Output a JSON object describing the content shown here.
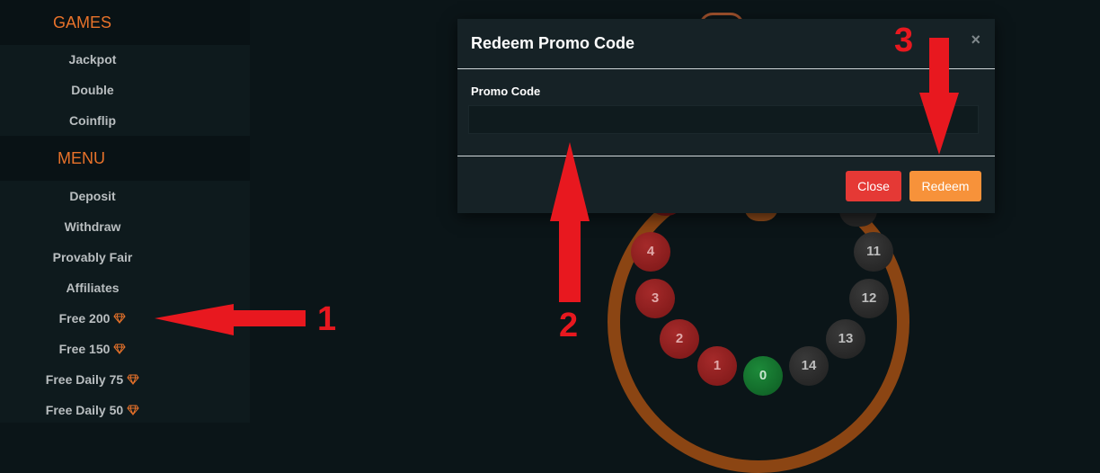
{
  "sidebar": {
    "games_heading": "GAMES",
    "games": [
      "Jackpot",
      "Double",
      "Coinflip"
    ],
    "menu_heading": "MENU",
    "menu": [
      "Deposit",
      "Withdraw",
      "Provably Fair",
      "Affiliates",
      "Free 200",
      "Free 150",
      "Free Daily 75",
      "Free Daily 50"
    ]
  },
  "wheel": {
    "balls": [
      {
        "label": "4",
        "color": "red"
      },
      {
        "label": "3",
        "color": "red"
      },
      {
        "label": "2",
        "color": "red"
      },
      {
        "label": "1",
        "color": "red"
      },
      {
        "label": "0",
        "color": "green"
      },
      {
        "label": "14",
        "color": "black"
      },
      {
        "label": "13",
        "color": "black"
      },
      {
        "label": "12",
        "color": "black"
      },
      {
        "label": "11",
        "color": "black"
      }
    ]
  },
  "modal": {
    "title": "Redeem Promo Code",
    "close_icon": "×",
    "field_label": "Promo Code",
    "field_value": "",
    "close_label": "Close",
    "redeem_label": "Redeem"
  },
  "annotations": [
    "1",
    "2",
    "3"
  ],
  "colors": {
    "accent": "#e8722a",
    "close_button": "#e53935",
    "redeem_button": "#f7923a",
    "annotation": "#e8181f",
    "wheel_ring": "#8b4513"
  }
}
